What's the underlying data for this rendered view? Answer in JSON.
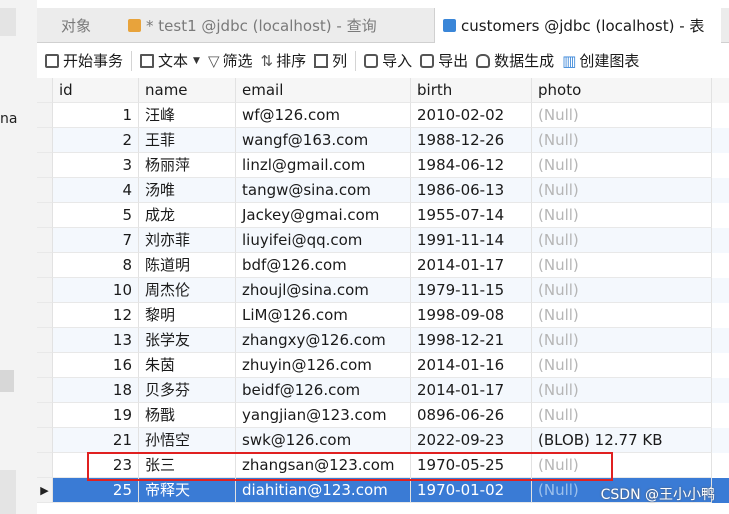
{
  "sidebar_fragment": {
    "text": "na"
  },
  "tabs": [
    {
      "label": "对象"
    },
    {
      "label": "* test1 @jdbc (localhost) - 查询"
    },
    {
      "label": "customers @jdbc (localhost) - 表"
    }
  ],
  "toolbar": {
    "begin_transaction": "开始事务",
    "text": "文本",
    "filter": "筛选",
    "sort": "排序",
    "columns": "列",
    "import": "导入",
    "export": "导出",
    "generate_data": "数据生成",
    "create_chart": "创建图表"
  },
  "columns": [
    "id",
    "name",
    "email",
    "birth",
    "photo"
  ],
  "rows": [
    {
      "id": "1",
      "name": "汪峰",
      "email": "wf@126.com",
      "birth": "2010-02-02",
      "photo": "(Null)"
    },
    {
      "id": "2",
      "name": "王菲",
      "email": "wangf@163.com",
      "birth": "1988-12-26",
      "photo": "(Null)"
    },
    {
      "id": "3",
      "name": "杨丽萍",
      "email": "linzl@gmail.com",
      "birth": "1984-06-12",
      "photo": "(Null)"
    },
    {
      "id": "4",
      "name": "汤唯",
      "email": "tangw@sina.com",
      "birth": "1986-06-13",
      "photo": "(Null)"
    },
    {
      "id": "5",
      "name": "成龙",
      "email": "Jackey@gmai.com",
      "birth": "1955-07-14",
      "photo": "(Null)"
    },
    {
      "id": "7",
      "name": "刘亦菲",
      "email": "liuyifei@qq.com",
      "birth": "1991-11-14",
      "photo": "(Null)"
    },
    {
      "id": "8",
      "name": "陈道明",
      "email": "bdf@126.com",
      "birth": "2014-01-17",
      "photo": "(Null)"
    },
    {
      "id": "10",
      "name": "周杰伦",
      "email": "zhoujl@sina.com",
      "birth": "1979-11-15",
      "photo": "(Null)"
    },
    {
      "id": "12",
      "name": "黎明",
      "email": "LiM@126.com",
      "birth": "1998-09-08",
      "photo": "(Null)"
    },
    {
      "id": "13",
      "name": "张学友",
      "email": "zhangxy@126.com",
      "birth": "1998-12-21",
      "photo": "(Null)"
    },
    {
      "id": "16",
      "name": "朱茵",
      "email": "zhuyin@126.com",
      "birth": "2014-01-16",
      "photo": "(Null)"
    },
    {
      "id": "18",
      "name": "贝多芬",
      "email": "beidf@126.com",
      "birth": "2014-01-17",
      "photo": "(Null)"
    },
    {
      "id": "19",
      "name": "杨戬",
      "email": "yangjian@123.com",
      "birth": "0896-06-26",
      "photo": "(Null)"
    },
    {
      "id": "21",
      "name": "孙悟空",
      "email": "swk@126.com",
      "birth": "2022-09-23",
      "photo": "(BLOB) 12.77 KB"
    },
    {
      "id": "23",
      "name": "张三",
      "email": "zhangsan@123.com",
      "birth": "1970-05-25",
      "photo": "(Null)"
    },
    {
      "id": "25",
      "name": "帝释天",
      "email": "diahitian@123.com",
      "birth": "1970-01-02",
      "photo": "(Null)"
    }
  ],
  "current_row_marker": "▶",
  "watermark": "CSDN @王小小鸭",
  "colors": {
    "selected_row": "#3a7bd5",
    "highlight_box": "#e02020",
    "null_text": "#b5b5b5"
  }
}
